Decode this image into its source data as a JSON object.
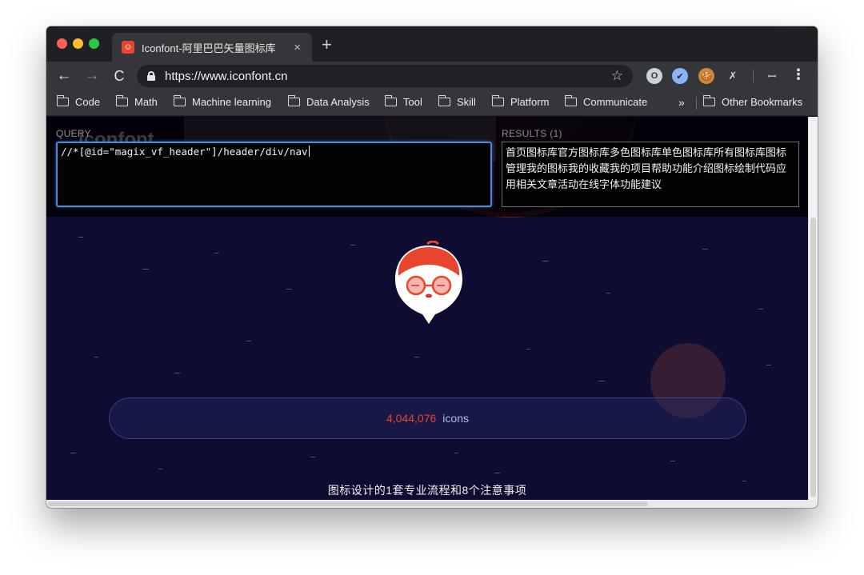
{
  "browser": {
    "tab": {
      "favicon": "iconfont-logo-icon",
      "title": "Iconfont-阿里巴巴矢量图标库",
      "close": "×"
    },
    "new_tab": "+",
    "nav": {
      "back": "←",
      "forward": "→",
      "reload": "C"
    },
    "address": {
      "url": "https://www.iconfont.cn",
      "star": "☆"
    },
    "extensions": [
      "O",
      "✔",
      "🍪",
      "✗",
      "ꟷ"
    ],
    "menu": "⋮"
  },
  "bookmarks": {
    "items": [
      "Code",
      "Math",
      "Machine learning",
      "Data Analysis",
      "Tool",
      "Skill",
      "Platform",
      "Communicate"
    ],
    "more": "»",
    "other": "Other Bookmarks"
  },
  "xpath_helper": {
    "query_label": "QUERY",
    "query_value": "//*[@id=\"magix_vf_header\"]/header/div/nav",
    "results_label": "RESULTS (1)",
    "results_value": "首页图标库官方图标库多色图标库单色图标库所有图标库图标管理我的图标我的收藏我的项目帮助功能介绍图标绘制代码应用相关文章活动在线字体功能建议",
    "faded_logo": "iconfont"
  },
  "hero": {
    "icon_count": "4,044,076",
    "icon_unit": "icons",
    "headline": "图标设计的1套专业流程和8个注意事项"
  },
  "colors": {
    "accent": "#e8452f",
    "page_bg": "#0f0c31",
    "focus_blue": "#4b8bd8"
  }
}
